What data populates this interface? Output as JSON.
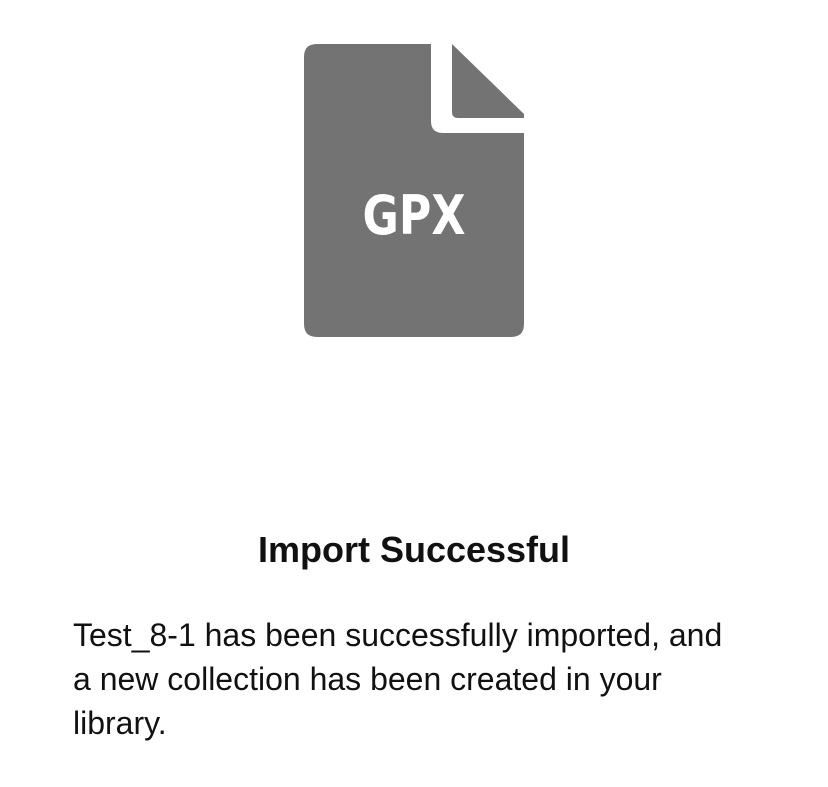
{
  "import_result": {
    "file_type": "GPX",
    "title": "Import Successful",
    "message": "Test_8-1 has been successfully imported, and a new collection has been created in your library."
  },
  "icon": {
    "name": "gpx-file-icon",
    "color": "#737373"
  }
}
